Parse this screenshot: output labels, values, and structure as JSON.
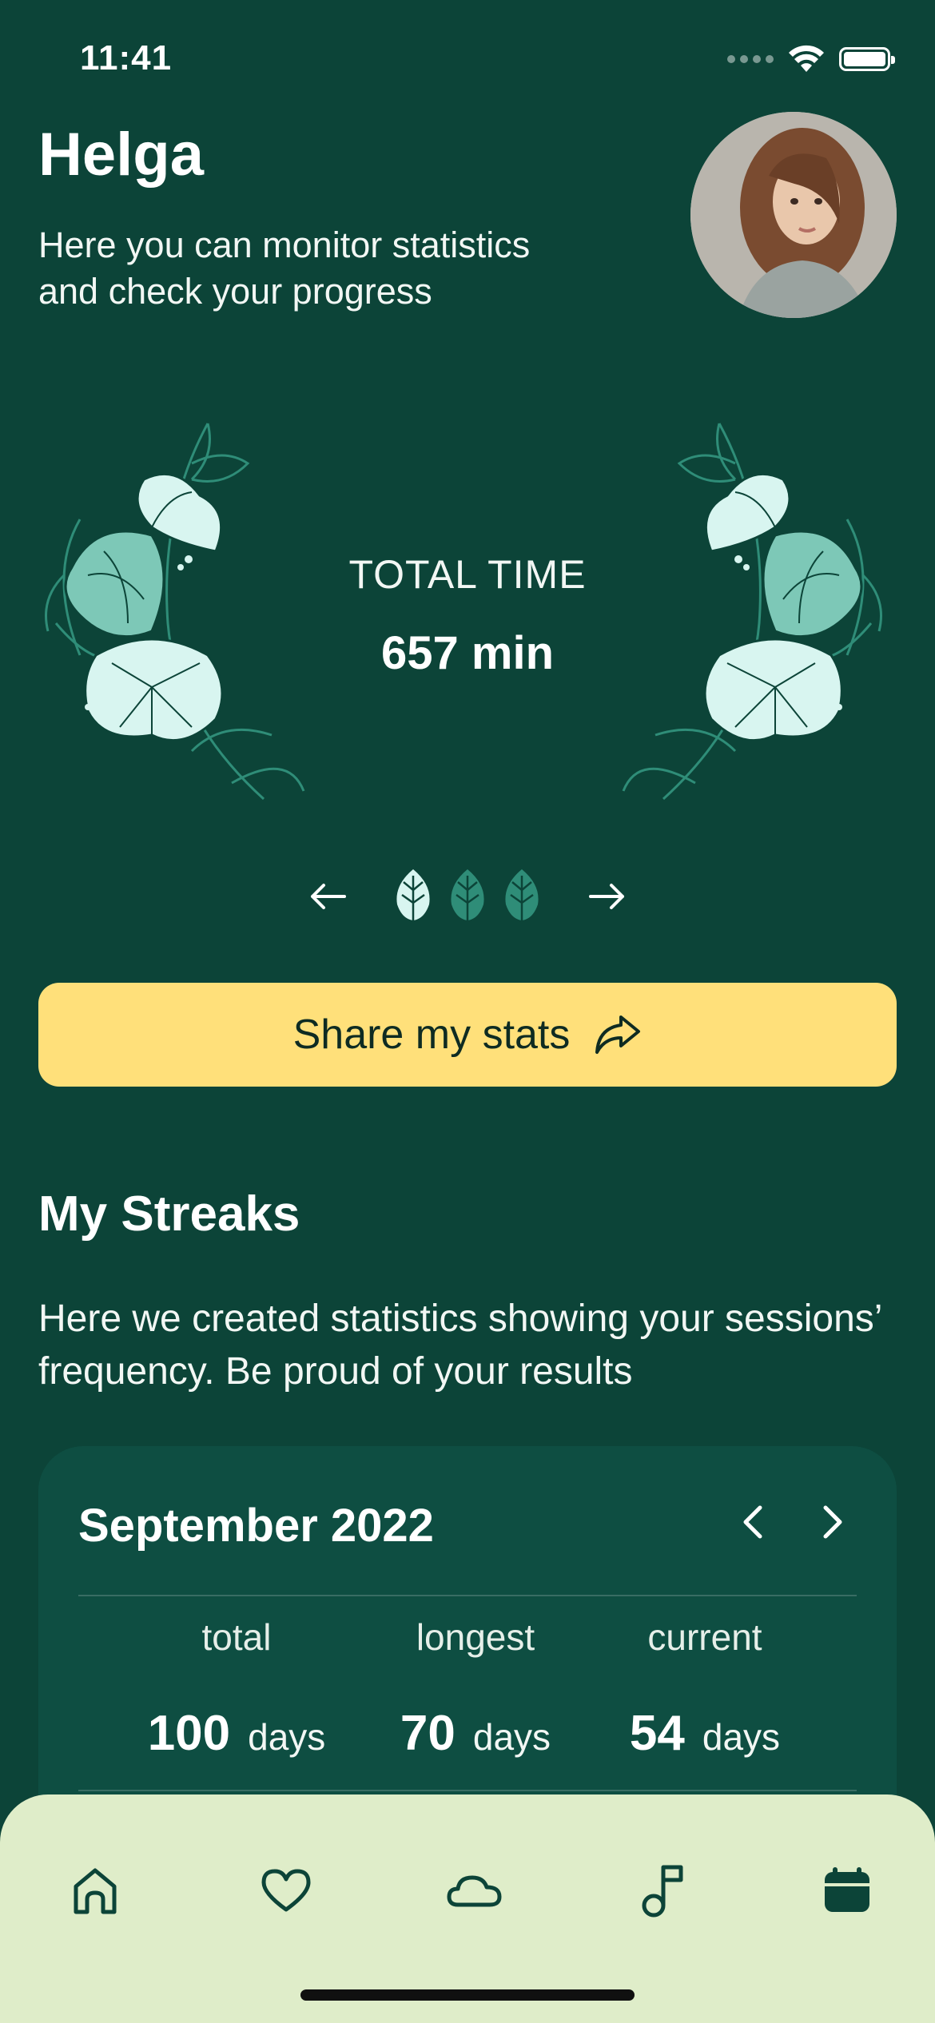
{
  "status_bar": {
    "time": "11:41",
    "icons": [
      "cellular-dots-icon",
      "wifi-icon",
      "battery-icon"
    ]
  },
  "header": {
    "name": "Helga",
    "subtitle": "Here you can monitor statistics and check your progress",
    "avatar": "user-avatar-photo"
  },
  "stats_carousel": {
    "label": "TOTAL TIME",
    "value": "657 min",
    "pages": 3,
    "active_page": 1,
    "prev_icon": "arrow-left-icon",
    "next_icon": "arrow-right-icon"
  },
  "share": {
    "label": "Share my stats",
    "icon": "share-arrow-icon"
  },
  "streaks": {
    "title": "My Streaks",
    "description": "Here we created statistics showing your sessions’ frequency. Be proud of your results",
    "month": "September 2022",
    "stats": [
      {
        "label": "total",
        "value": "100",
        "unit": "days"
      },
      {
        "label": "longest",
        "value": "70",
        "unit": "days"
      },
      {
        "label": "current",
        "value": "54",
        "unit": "days"
      }
    ]
  },
  "tab_bar": {
    "items": [
      "home-icon",
      "heart-icon",
      "cloud-icon",
      "music-note-icon",
      "calendar-icon"
    ],
    "active": "calendar-icon"
  },
  "colors": {
    "background": "#0c4438",
    "card": "#0e4e42",
    "accent_yellow": "#ffe07a",
    "tab_bar": "#dfedc9",
    "icon_dark": "#0c4438",
    "leaf_light": "#d8f5f0",
    "leaf_teal": "#5fb8a6"
  }
}
